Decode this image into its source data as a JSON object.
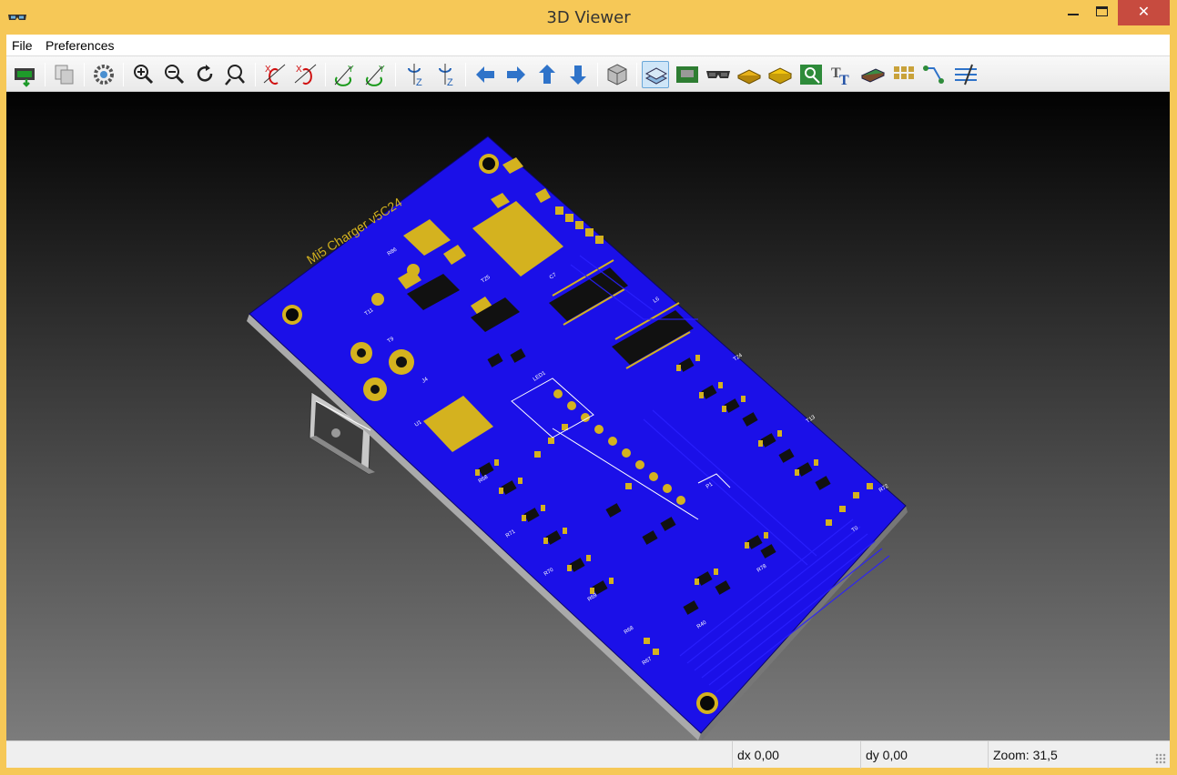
{
  "window": {
    "title": "3D Viewer"
  },
  "menu": {
    "items": [
      "File",
      "Preferences"
    ]
  },
  "toolbar": {
    "buttons": [
      {
        "name": "reload-board-icon"
      },
      {
        "name": "copy-image-icon"
      },
      {
        "name": "display-options-icon"
      },
      {
        "name": "zoom-in-icon"
      },
      {
        "name": "zoom-out-icon"
      },
      {
        "name": "redraw-icon"
      },
      {
        "name": "zoom-fit-icon"
      },
      {
        "name": "rotate-x-cw-icon"
      },
      {
        "name": "rotate-x-ccw-icon"
      },
      {
        "name": "rotate-y-cw-icon"
      },
      {
        "name": "rotate-y-ccw-icon"
      },
      {
        "name": "rotate-z-cw-icon"
      },
      {
        "name": "rotate-z-ccw-icon"
      },
      {
        "name": "move-left-icon"
      },
      {
        "name": "move-right-icon"
      },
      {
        "name": "move-up-icon"
      },
      {
        "name": "move-down-icon"
      },
      {
        "name": "perspective-icon"
      },
      {
        "name": "toggle-realistic-icon"
      },
      {
        "name": "toggle-3d-models-icon"
      },
      {
        "name": "toggle-silkscreen-icon"
      },
      {
        "name": "toggle-soldermask-icon"
      },
      {
        "name": "toggle-paste-icon"
      },
      {
        "name": "toggle-copper-icon"
      },
      {
        "name": "toggle-text-icon"
      },
      {
        "name": "toggle-board-body-icon"
      },
      {
        "name": "toggle-grid-icon"
      },
      {
        "name": "toggle-tracks-icon"
      },
      {
        "name": "toggle-edges-icon"
      }
    ],
    "active_index": 18
  },
  "viewport": {
    "board_text": "Mi5 Charger v5C24"
  },
  "status": {
    "dx": "dx 0,00",
    "dy": "dy 0,00",
    "zoom": "Zoom: 31,5"
  },
  "colors": {
    "board_mask": "#1b10e8",
    "copper": "#d4b21f",
    "silkscreen": "#ffffff",
    "titlebar": "#f6c857",
    "close_button": "#c74b3f"
  }
}
